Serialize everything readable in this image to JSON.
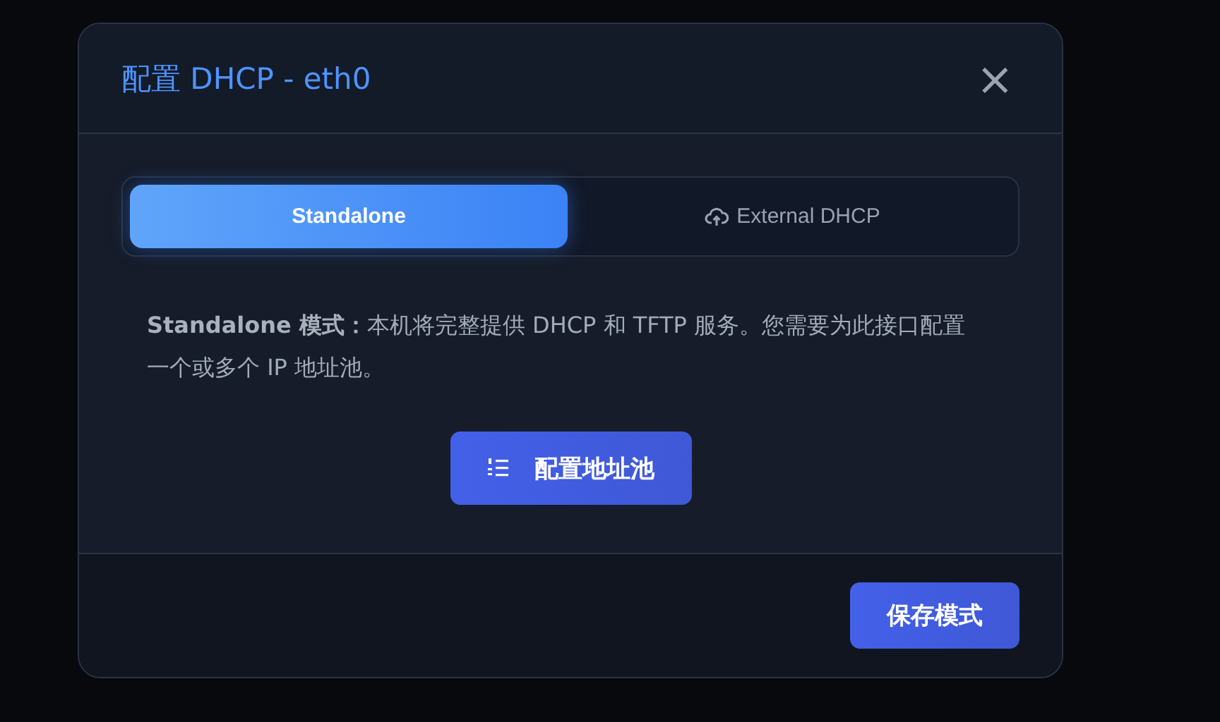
{
  "dialog": {
    "title": "配置 DHCP - eth0",
    "close": "×"
  },
  "tabs": [
    {
      "label": "Standalone",
      "selected": true,
      "kind": "plain"
    },
    {
      "label": "External DHCP",
      "selected": false,
      "kind": "cloud"
    }
  ],
  "description": "**Standalone 模式：**本机将完整提供 DHCP 和 TFTP 服务。您需要为此接口配置一个或多个 IP 地址池。",
  "action_button": {
    "label": "配置地址池"
  },
  "footer_button": {
    "label": "保存模式"
  }
}
